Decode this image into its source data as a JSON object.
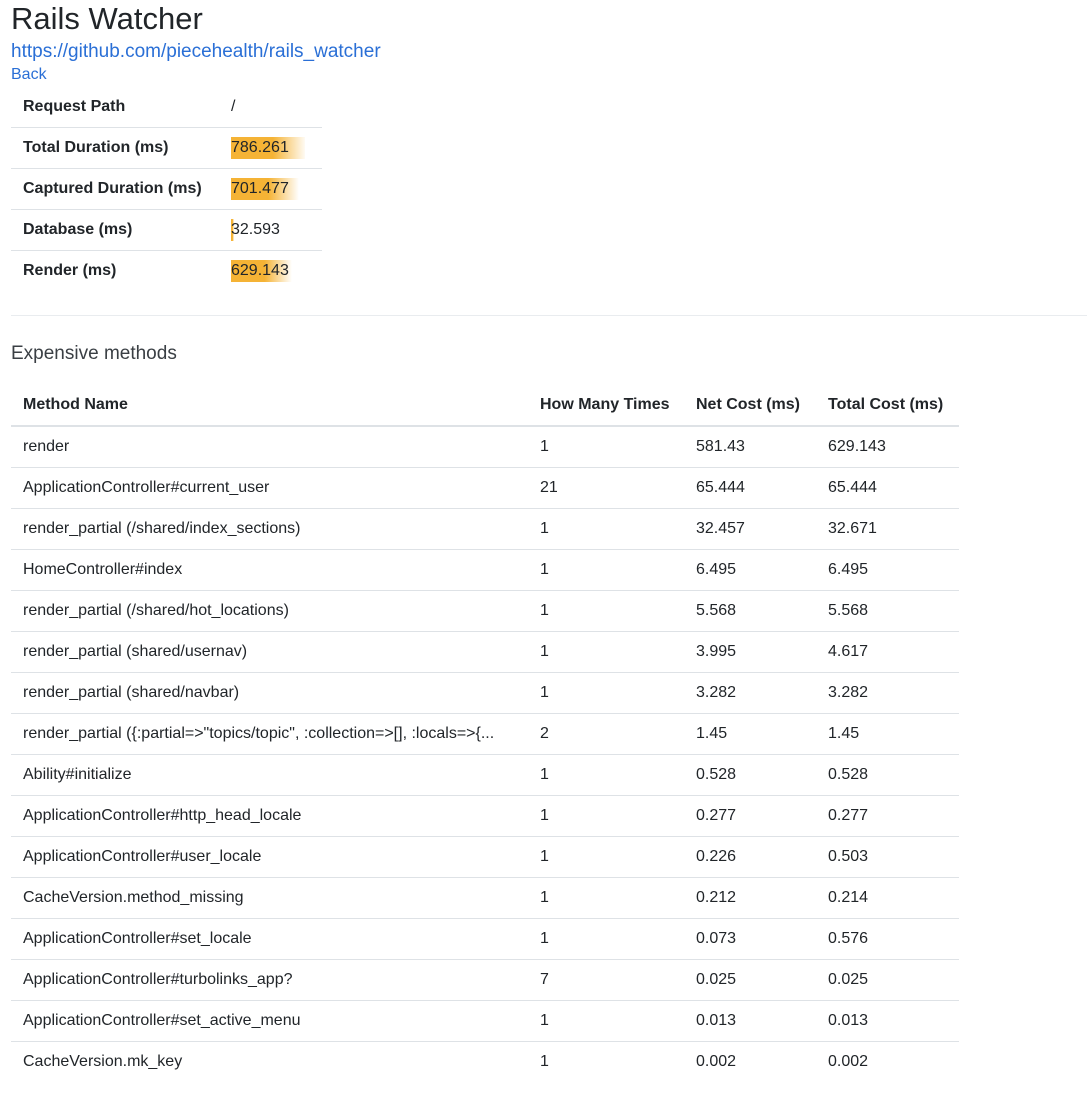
{
  "header": {
    "title": "Rails Watcher",
    "repo_link": "https://github.com/piecehealth/rails_watcher",
    "back_link": "Back"
  },
  "summary": [
    {
      "label": "Request Path",
      "value": "/",
      "bar_fraction": 0
    },
    {
      "label": "Total Duration (ms)",
      "value": "786.261",
      "bar_fraction": 1.0
    },
    {
      "label": "Captured Duration (ms)",
      "value": "701.477",
      "bar_fraction": 0.892
    },
    {
      "label": "Database (ms)",
      "value": "32.593",
      "bar_fraction": 0.041
    },
    {
      "label": "Render (ms)",
      "value": "629.143",
      "bar_fraction": 0.8
    }
  ],
  "bar_color": "#f5b335",
  "section_title": "Expensive methods",
  "methods_table": {
    "columns": [
      "Method Name",
      "How Many Times",
      "Net Cost (ms)",
      "Total Cost (ms)"
    ],
    "rows": [
      [
        "render",
        "1",
        "581.43",
        "629.143"
      ],
      [
        "ApplicationController#current_user",
        "21",
        "65.444",
        "65.444"
      ],
      [
        "render_partial (/shared/index_sections)",
        "1",
        "32.457",
        "32.671"
      ],
      [
        "HomeController#index",
        "1",
        "6.495",
        "6.495"
      ],
      [
        "render_partial (/shared/hot_locations)",
        "1",
        "5.568",
        "5.568"
      ],
      [
        "render_partial (shared/usernav)",
        "1",
        "3.995",
        "4.617"
      ],
      [
        "render_partial (shared/navbar)",
        "1",
        "3.282",
        "3.282"
      ],
      [
        "render_partial ({:partial=>\"topics/topic\", :collection=>[], :locals=>{...",
        "2",
        "1.45",
        "1.45"
      ],
      [
        "Ability#initialize",
        "1",
        "0.528",
        "0.528"
      ],
      [
        "ApplicationController#http_head_locale",
        "1",
        "0.277",
        "0.277"
      ],
      [
        "ApplicationController#user_locale",
        "1",
        "0.226",
        "0.503"
      ],
      [
        "CacheVersion.method_missing",
        "1",
        "0.212",
        "0.214"
      ],
      [
        "ApplicationController#set_locale",
        "1",
        "0.073",
        "0.576"
      ],
      [
        "ApplicationController#turbolinks_app?",
        "7",
        "0.025",
        "0.025"
      ],
      [
        "ApplicationController#set_active_menu",
        "1",
        "0.013",
        "0.013"
      ],
      [
        "CacheVersion.mk_key",
        "1",
        "0.002",
        "0.002"
      ]
    ]
  }
}
